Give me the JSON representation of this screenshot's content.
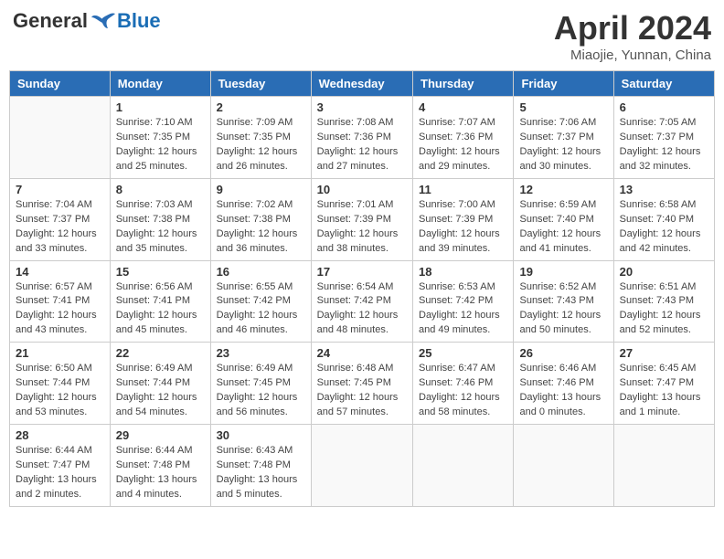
{
  "header": {
    "logo": {
      "general": "General",
      "blue": "Blue"
    },
    "title": "April 2024",
    "subtitle": "Miaojie, Yunnan, China"
  },
  "calendar": {
    "weekdays": [
      "Sunday",
      "Monday",
      "Tuesday",
      "Wednesday",
      "Thursday",
      "Friday",
      "Saturday"
    ],
    "weeks": [
      [
        {
          "day": "",
          "info": ""
        },
        {
          "day": "1",
          "info": "Sunrise: 7:10 AM\nSunset: 7:35 PM\nDaylight: 12 hours\nand 25 minutes."
        },
        {
          "day": "2",
          "info": "Sunrise: 7:09 AM\nSunset: 7:35 PM\nDaylight: 12 hours\nand 26 minutes."
        },
        {
          "day": "3",
          "info": "Sunrise: 7:08 AM\nSunset: 7:36 PM\nDaylight: 12 hours\nand 27 minutes."
        },
        {
          "day": "4",
          "info": "Sunrise: 7:07 AM\nSunset: 7:36 PM\nDaylight: 12 hours\nand 29 minutes."
        },
        {
          "day": "5",
          "info": "Sunrise: 7:06 AM\nSunset: 7:37 PM\nDaylight: 12 hours\nand 30 minutes."
        },
        {
          "day": "6",
          "info": "Sunrise: 7:05 AM\nSunset: 7:37 PM\nDaylight: 12 hours\nand 32 minutes."
        }
      ],
      [
        {
          "day": "7",
          "info": "Sunrise: 7:04 AM\nSunset: 7:37 PM\nDaylight: 12 hours\nand 33 minutes."
        },
        {
          "day": "8",
          "info": "Sunrise: 7:03 AM\nSunset: 7:38 PM\nDaylight: 12 hours\nand 35 minutes."
        },
        {
          "day": "9",
          "info": "Sunrise: 7:02 AM\nSunset: 7:38 PM\nDaylight: 12 hours\nand 36 minutes."
        },
        {
          "day": "10",
          "info": "Sunrise: 7:01 AM\nSunset: 7:39 PM\nDaylight: 12 hours\nand 38 minutes."
        },
        {
          "day": "11",
          "info": "Sunrise: 7:00 AM\nSunset: 7:39 PM\nDaylight: 12 hours\nand 39 minutes."
        },
        {
          "day": "12",
          "info": "Sunrise: 6:59 AM\nSunset: 7:40 PM\nDaylight: 12 hours\nand 41 minutes."
        },
        {
          "day": "13",
          "info": "Sunrise: 6:58 AM\nSunset: 7:40 PM\nDaylight: 12 hours\nand 42 minutes."
        }
      ],
      [
        {
          "day": "14",
          "info": "Sunrise: 6:57 AM\nSunset: 7:41 PM\nDaylight: 12 hours\nand 43 minutes."
        },
        {
          "day": "15",
          "info": "Sunrise: 6:56 AM\nSunset: 7:41 PM\nDaylight: 12 hours\nand 45 minutes."
        },
        {
          "day": "16",
          "info": "Sunrise: 6:55 AM\nSunset: 7:42 PM\nDaylight: 12 hours\nand 46 minutes."
        },
        {
          "day": "17",
          "info": "Sunrise: 6:54 AM\nSunset: 7:42 PM\nDaylight: 12 hours\nand 48 minutes."
        },
        {
          "day": "18",
          "info": "Sunrise: 6:53 AM\nSunset: 7:42 PM\nDaylight: 12 hours\nand 49 minutes."
        },
        {
          "day": "19",
          "info": "Sunrise: 6:52 AM\nSunset: 7:43 PM\nDaylight: 12 hours\nand 50 minutes."
        },
        {
          "day": "20",
          "info": "Sunrise: 6:51 AM\nSunset: 7:43 PM\nDaylight: 12 hours\nand 52 minutes."
        }
      ],
      [
        {
          "day": "21",
          "info": "Sunrise: 6:50 AM\nSunset: 7:44 PM\nDaylight: 12 hours\nand 53 minutes."
        },
        {
          "day": "22",
          "info": "Sunrise: 6:49 AM\nSunset: 7:44 PM\nDaylight: 12 hours\nand 54 minutes."
        },
        {
          "day": "23",
          "info": "Sunrise: 6:49 AM\nSunset: 7:45 PM\nDaylight: 12 hours\nand 56 minutes."
        },
        {
          "day": "24",
          "info": "Sunrise: 6:48 AM\nSunset: 7:45 PM\nDaylight: 12 hours\nand 57 minutes."
        },
        {
          "day": "25",
          "info": "Sunrise: 6:47 AM\nSunset: 7:46 PM\nDaylight: 12 hours\nand 58 minutes."
        },
        {
          "day": "26",
          "info": "Sunrise: 6:46 AM\nSunset: 7:46 PM\nDaylight: 13 hours\nand 0 minutes."
        },
        {
          "day": "27",
          "info": "Sunrise: 6:45 AM\nSunset: 7:47 PM\nDaylight: 13 hours\nand 1 minute."
        }
      ],
      [
        {
          "day": "28",
          "info": "Sunrise: 6:44 AM\nSunset: 7:47 PM\nDaylight: 13 hours\nand 2 minutes."
        },
        {
          "day": "29",
          "info": "Sunrise: 6:44 AM\nSunset: 7:48 PM\nDaylight: 13 hours\nand 4 minutes."
        },
        {
          "day": "30",
          "info": "Sunrise: 6:43 AM\nSunset: 7:48 PM\nDaylight: 13 hours\nand 5 minutes."
        },
        {
          "day": "",
          "info": ""
        },
        {
          "day": "",
          "info": ""
        },
        {
          "day": "",
          "info": ""
        },
        {
          "day": "",
          "info": ""
        }
      ]
    ]
  }
}
